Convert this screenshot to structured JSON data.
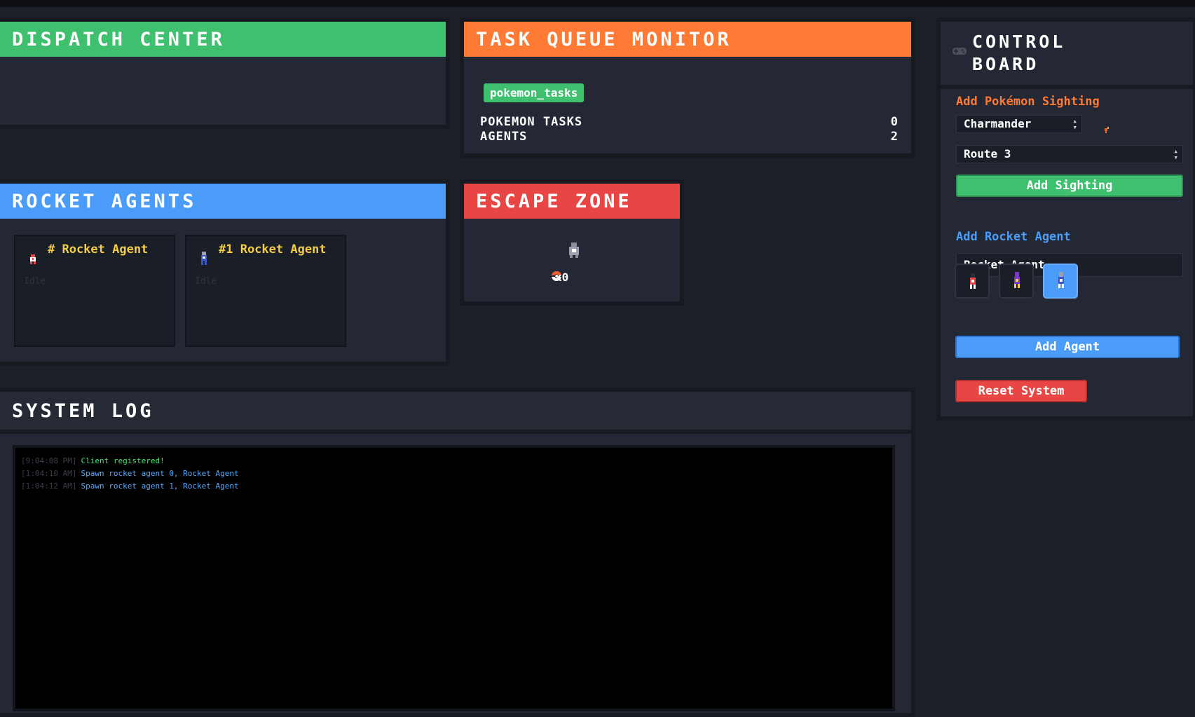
{
  "panels": {
    "dispatch": {
      "title": "DISPATCH CENTER"
    },
    "task_queue": {
      "title": "TASK QUEUE MONITOR",
      "queue_name": "pokemon_tasks",
      "stats": [
        {
          "label": "POKEMON TASKS",
          "value": "0"
        },
        {
          "label": "AGENTS",
          "value": "2"
        }
      ]
    },
    "rocket_agents": {
      "title": "ROCKET AGENTS",
      "agents": [
        {
          "name": "# Rocket Agent",
          "status": "Idle",
          "sprite": "rocket-agent-red-icon"
        },
        {
          "name": "#1 Rocket Agent",
          "status": "Idle",
          "sprite": "rocket-agent-blue-icon"
        }
      ]
    },
    "escape_zone": {
      "title": "ESCAPE ZONE",
      "count": "x0",
      "icons": [
        "escape-robot-icon",
        "pokeball-icon"
      ]
    },
    "system_log": {
      "title": "SYSTEM LOG",
      "entries": [
        {
          "time": "[9:04:08 PM]",
          "message": "Client registered!",
          "color": "#4fe07a"
        },
        {
          "time": "[1:04:10 AM]",
          "message": "Spawn rocket agent 0, Rocket Agent",
          "color": "#5aa9ff"
        },
        {
          "time": "[1:04:12 AM]",
          "message": "Spawn rocket agent 1, Rocket Agent",
          "color": "#5aa9ff"
        }
      ]
    },
    "control_board": {
      "title_line1": "CONTROL",
      "title_line2": "BOARD",
      "icon": "gamepad-icon",
      "sighting": {
        "title": "Add Pokémon Sighting",
        "pokemon_select": "Charmander",
        "route_select": "Route 3",
        "button": "Add Sighting"
      },
      "agent": {
        "title": "Add Rocket Agent",
        "name_value": "Rocket Agent",
        "avatars": [
          "red-agent-avatar",
          "purple-agent-avatar",
          "blue-agent-avatar"
        ],
        "selected_avatar": 2,
        "button": "Add Agent"
      },
      "reset_button": "Reset System"
    }
  },
  "colors": {
    "green": "#3ec06e",
    "orange": "#ff7a35",
    "blue": "#4a9cf8",
    "red": "#e84545",
    "yellow": "#f3cd46"
  }
}
